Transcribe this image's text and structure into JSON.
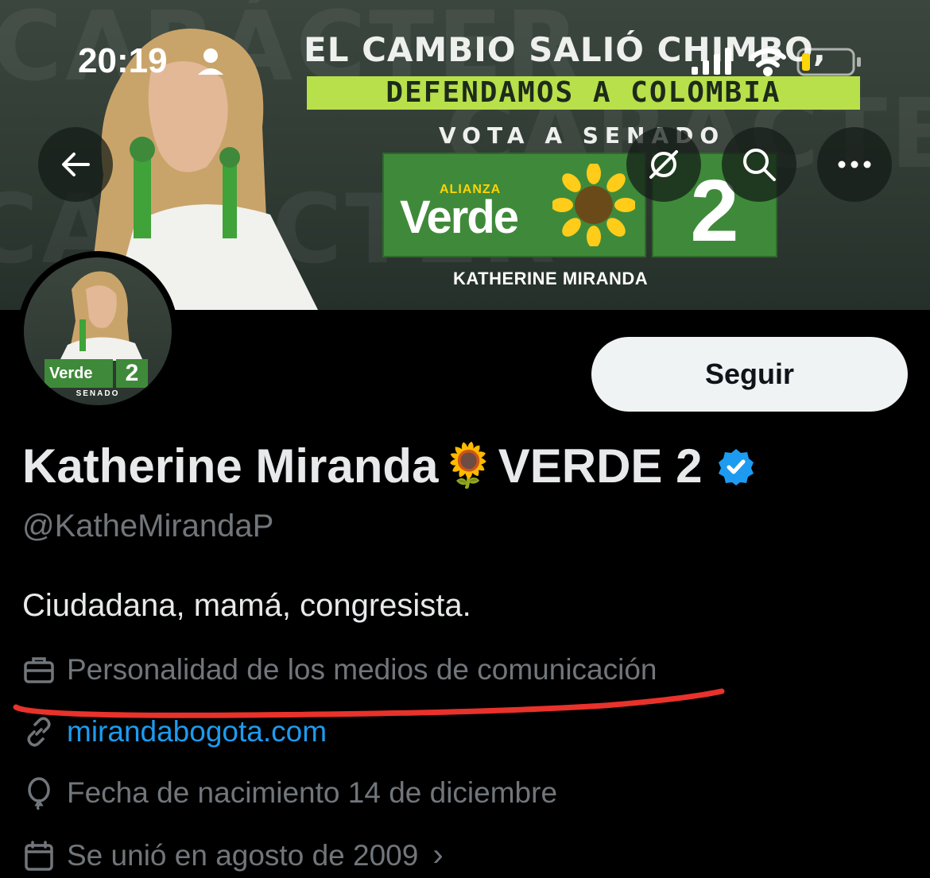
{
  "status_bar": {
    "time": "20:19"
  },
  "banner": {
    "background_word": "CARÁCTER",
    "headline": "EL CAMBIO SALIÓ CHIMBO,",
    "subheadline": "DEFENDAMOS A COLOMBIA",
    "vote_text": "VOTA A SENADO",
    "party_small": "ALIANZA",
    "party_name": "Verde",
    "list_number": "2",
    "candidate_name": "KATHERINE MIRANDA"
  },
  "avatar": {
    "party_name": "Verde",
    "number": "2",
    "caption": "SENADO"
  },
  "toolbar": {
    "back_icon": "arrow-left-icon",
    "hide_icon": "eye-slash-icon",
    "search_icon": "search-icon",
    "more_icon": "more-horizontal-icon"
  },
  "profile": {
    "follow_label": "Seguir",
    "name_part1": "Katherine Miranda",
    "emoji": "🌻",
    "name_part2": "VERDE 2",
    "verified": true,
    "handle": "@KatheMirandaP",
    "bio": "Ciudadana, mamá, congresista.",
    "category": "Personalidad de los medios de comunicación",
    "website": "mirandabogota.com",
    "birthday": "Fecha de nacimiento 14 de diciembre",
    "joined": "Se unió en agosto de 2009",
    "joined_chevron": "›"
  },
  "colors": {
    "accent_blue": "#1d9bf0",
    "annotation_red": "#e8322b",
    "banner_green": "#3f8a3a",
    "highlight_lime": "#b8e04a"
  }
}
